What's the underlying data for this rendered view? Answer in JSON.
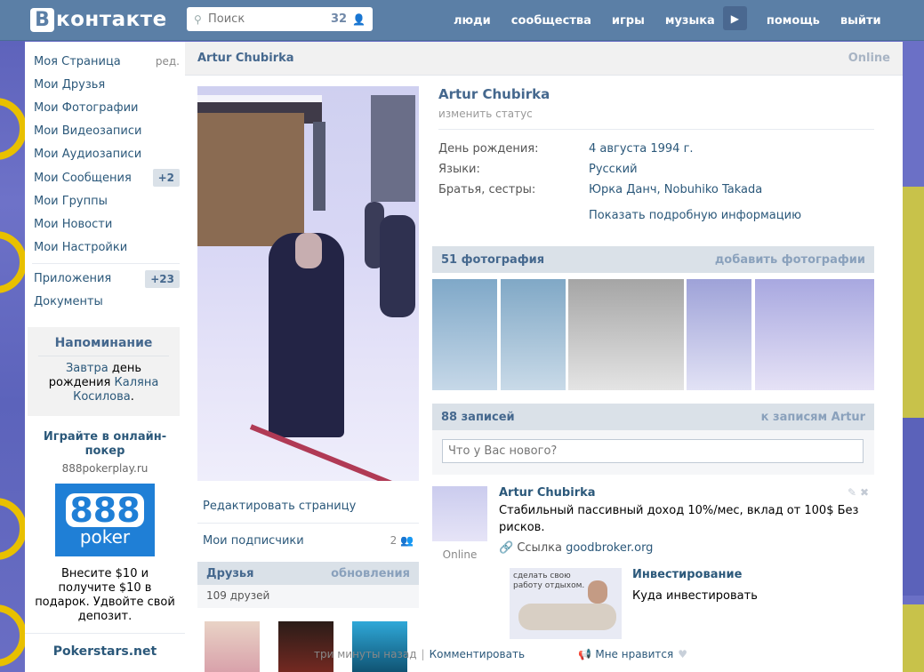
{
  "header": {
    "logo_letter": "В",
    "logo_text": "контакте",
    "search_placeholder": "Поиск",
    "search_count": "32",
    "nav": [
      "люди",
      "сообщества",
      "игры",
      "музыка",
      "помощь",
      "выйти"
    ]
  },
  "sidebar": {
    "items": [
      {
        "label": "Моя Страница",
        "extra": "ред."
      },
      {
        "label": "Мои Друзья"
      },
      {
        "label": "Мои Фотографии"
      },
      {
        "label": "Мои Видеозаписи"
      },
      {
        "label": "Мои Аудиозаписи"
      },
      {
        "label": "Мои Сообщения",
        "badge": "+2"
      },
      {
        "label": "Мои Группы"
      },
      {
        "label": "Мои Новости"
      },
      {
        "label": "Мои Настройки"
      }
    ],
    "apps": [
      {
        "label": "Приложения",
        "badge": "+23"
      },
      {
        "label": "Документы"
      }
    ],
    "reminder": {
      "title": "Напоминание",
      "when": "Завтра",
      "text_mid": "день рождения",
      "person": "Каляна Косилова"
    },
    "ad": {
      "title": "Играйте в онлайн-покер",
      "domain": "888pokerplay.ru",
      "img_big": "888",
      "img_small": "poker",
      "text": "Внесите $10 и получите $10 в подарок. Удвойте свой депозит."
    },
    "ad2": {
      "title": "Pokerstars.net"
    }
  },
  "main": {
    "head_name": "Artur Chubirka",
    "head_status": "Online",
    "profile": {
      "name": "Artur Chubirka",
      "status": "изменить статус",
      "rows": [
        {
          "label": "День рождения:",
          "value": "4 августа 1994 г."
        },
        {
          "label": "Языки:",
          "value": "Русский"
        },
        {
          "label": "Братья, сестры:",
          "value": "Юрка Данч, Nobuhiko Takada"
        }
      ],
      "more": "Показать подробную информацию"
    },
    "links": {
      "edit": "Редактировать страницу",
      "subs": "Мои подписчики",
      "subs_count": "2"
    },
    "friends": {
      "title": "Друзья",
      "updates": "обновления",
      "count": "109 друзей"
    },
    "photos": {
      "title": "51 фотография",
      "add": "добавить фотографии"
    },
    "wall": {
      "title": "88 записей",
      "to_posts": "к записям Artur",
      "input_placeholder": "Что у Вас нового?"
    },
    "post": {
      "author": "Artur Chubirka",
      "text": "Стабильный пассивный доход 10%/мес, вклад от 100$ Без рисков.",
      "link_label": "Ссылка",
      "link_domain": "goodbroker.org",
      "card_title": "Инвестирование",
      "card_sub": "Куда инвестировать",
      "card_img_text": "сделать свою работу отдыхом.",
      "online": "Online",
      "time": "три минуты назад",
      "comment": "Комментировать",
      "like": "Мне нравится"
    }
  },
  "colors": {
    "header_bg": "#5b7fa6",
    "link": "#2b587a",
    "section_bg": "#dae1e8"
  }
}
